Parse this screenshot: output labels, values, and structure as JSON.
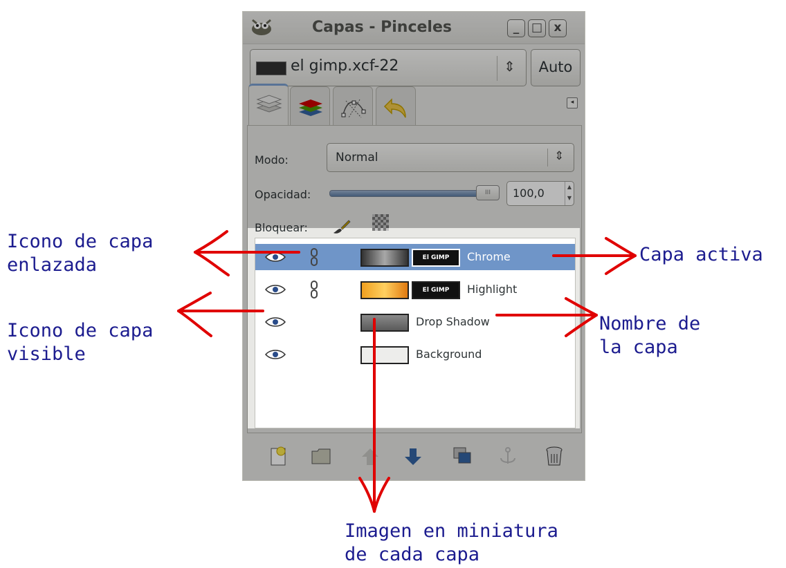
{
  "window": {
    "title": "Capas - Pinceles",
    "controls": {
      "minimize": "_",
      "maximize": "□",
      "close": "x"
    }
  },
  "image_selector": {
    "value": "el gimp.xcf-22",
    "auto_label": "Auto"
  },
  "tabs": [
    {
      "name": "layers",
      "icon": "layers-icon",
      "active": true
    },
    {
      "name": "channels",
      "icon": "channels-icon",
      "active": false
    },
    {
      "name": "paths",
      "icon": "paths-icon",
      "active": false
    },
    {
      "name": "undo",
      "icon": "undo-icon",
      "active": false
    }
  ],
  "mode": {
    "label": "Modo:",
    "value": "Normal"
  },
  "opacity": {
    "label": "Opacidad:",
    "value": "100,0",
    "level": 1.0
  },
  "lock": {
    "label": "Bloquear:"
  },
  "layers": [
    {
      "name": "Chrome",
      "visible": true,
      "linked": true,
      "active": true,
      "mask_text": "El GIMP"
    },
    {
      "name": "Highlight",
      "visible": true,
      "linked": true,
      "active": false,
      "mask_text": "El GIMP"
    },
    {
      "name": "Drop Shadow",
      "visible": true,
      "linked": false,
      "active": false
    },
    {
      "name": "Background",
      "visible": true,
      "linked": false,
      "active": false
    }
  ],
  "bottom_toolbar": [
    "new-layer-icon",
    "new-layer-group-icon",
    "raise-layer-icon",
    "lower-layer-icon",
    "duplicate-layer-icon",
    "anchor-layer-icon",
    "delete-layer-icon"
  ],
  "annotations": {
    "linked": "Icono de capa\nenlazada",
    "visible": "Icono de capa\nvisible",
    "active": "Capa activa",
    "name": "Nombre de\nla capa",
    "thumbnail": "Imagen en miniatura\nde cada capa"
  },
  "colors": {
    "annotation_text": "#1c1c8f",
    "arrow": "#e00000",
    "active_row": "#6f95c8"
  }
}
